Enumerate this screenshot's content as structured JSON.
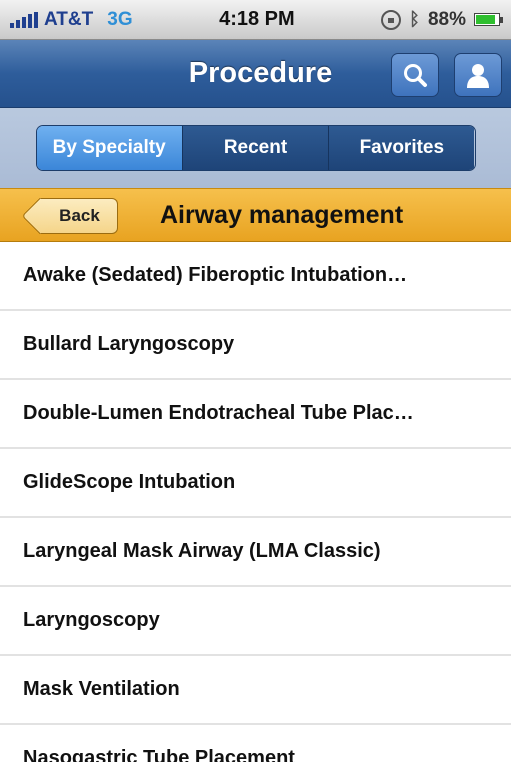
{
  "status_bar": {
    "carrier": "AT&T",
    "network": "3G",
    "time": "4:18 PM",
    "battery": "88%",
    "battery_level": 0.88,
    "icons": [
      "signal-icon",
      "rotation-lock-icon",
      "bluetooth-icon",
      "battery-icon"
    ]
  },
  "nav": {
    "title": "Procedure",
    "buttons": [
      "search-icon",
      "user-icon"
    ]
  },
  "segments": [
    {
      "label": "By Specialty",
      "active": true
    },
    {
      "label": "Recent",
      "active": false
    },
    {
      "label": "Favorites",
      "active": false
    }
  ],
  "category": {
    "back_label": "Back",
    "title": "Airway management"
  },
  "procedures": [
    "Awake (Sedated) Fiberoptic Intubation…",
    "Bullard Laryngoscopy",
    "Double-Lumen Endotracheal Tube Plac…",
    "GlideScope Intubation",
    "Laryngeal Mask Airway (LMA Classic)",
    "Laryngoscopy",
    "Mask Ventilation",
    "Nasogastric Tube Placement"
  ],
  "colors": {
    "nav_blue": "#2e5d9b",
    "segment_active": "#3b86d8",
    "category_orange": "#e8a321"
  }
}
